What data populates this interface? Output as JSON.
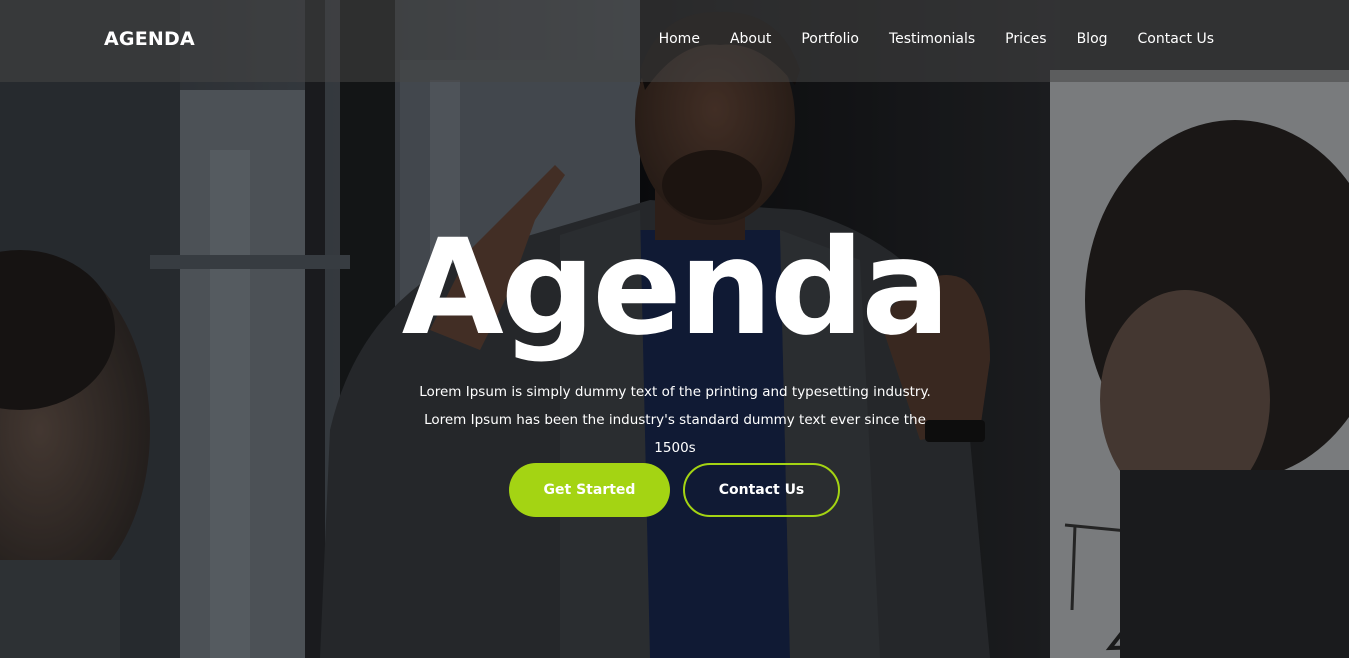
{
  "brand": {
    "name": "AGENDA"
  },
  "nav": {
    "items": [
      {
        "label": "Home"
      },
      {
        "label": "About"
      },
      {
        "label": "Portfolio"
      },
      {
        "label": "Testimonials"
      },
      {
        "label": "Prices"
      },
      {
        "label": "Blog"
      },
      {
        "label": "Contact Us"
      }
    ]
  },
  "hero": {
    "title": "Agenda",
    "subtitle": "Lorem Ipsum is simply dummy text of the printing and typesetting industry. Lorem Ipsum has been the industry's standard dummy text ever since the 1500s",
    "primary_button": "Get Started",
    "secondary_button": "Contact Us"
  },
  "colors": {
    "accent": "#a4d413",
    "text": "#ffffff"
  }
}
